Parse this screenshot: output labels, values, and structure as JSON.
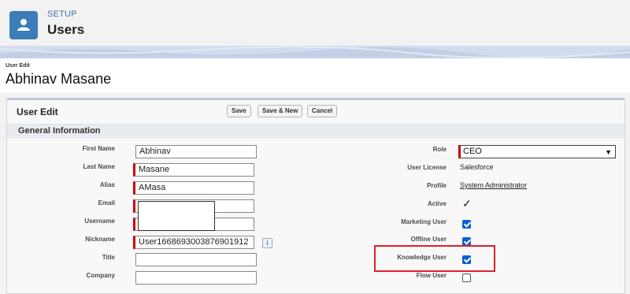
{
  "header": {
    "setup_label": "SETUP",
    "title": "Users",
    "icon": "user-icon"
  },
  "page": {
    "subtitle": "User Edit",
    "title": "Abhinav Masane"
  },
  "panel": {
    "title": "User Edit",
    "buttons": {
      "save": "Save",
      "save_new": "Save & New",
      "cancel": "Cancel"
    },
    "section_title": "General Information"
  },
  "left_fields": {
    "first_name": {
      "label": "First Name",
      "value": "Abhinav",
      "required": false
    },
    "last_name": {
      "label": "Last Name",
      "value": "Masane",
      "required": true
    },
    "alias": {
      "label": "Alias",
      "value": "AMasa",
      "required": true
    },
    "email": {
      "label": "Email",
      "value": "",
      "required": true
    },
    "username": {
      "label": "Username",
      "value": "",
      "required": true
    },
    "nickname": {
      "label": "Nickname",
      "value": "User16686930038769019​12",
      "required": true
    },
    "title": {
      "label": "Title",
      "value": ""
    },
    "company": {
      "label": "Company",
      "value": ""
    }
  },
  "right_fields": {
    "role": {
      "label": "Role",
      "value": "CEO"
    },
    "user_license": {
      "label": "User License",
      "value": "Salesforce"
    },
    "profile": {
      "label": "Profile",
      "value": "System Administrator"
    },
    "active": {
      "label": "Active",
      "value": "✓"
    },
    "marketing_user": {
      "label": "Marketing User",
      "checked": true
    },
    "offline_user": {
      "label": "Offline User",
      "checked": true
    },
    "knowledge_user": {
      "label": "Knowledge User",
      "checked": true
    },
    "flow_user": {
      "label": "Flow User",
      "checked": false
    }
  },
  "info_icon": {
    "glyph": "i"
  },
  "colors": {
    "accent": "#3c7cb8",
    "required": "#cc0000",
    "checkbox": "#0a5fd3",
    "highlight": "#e0202a"
  }
}
